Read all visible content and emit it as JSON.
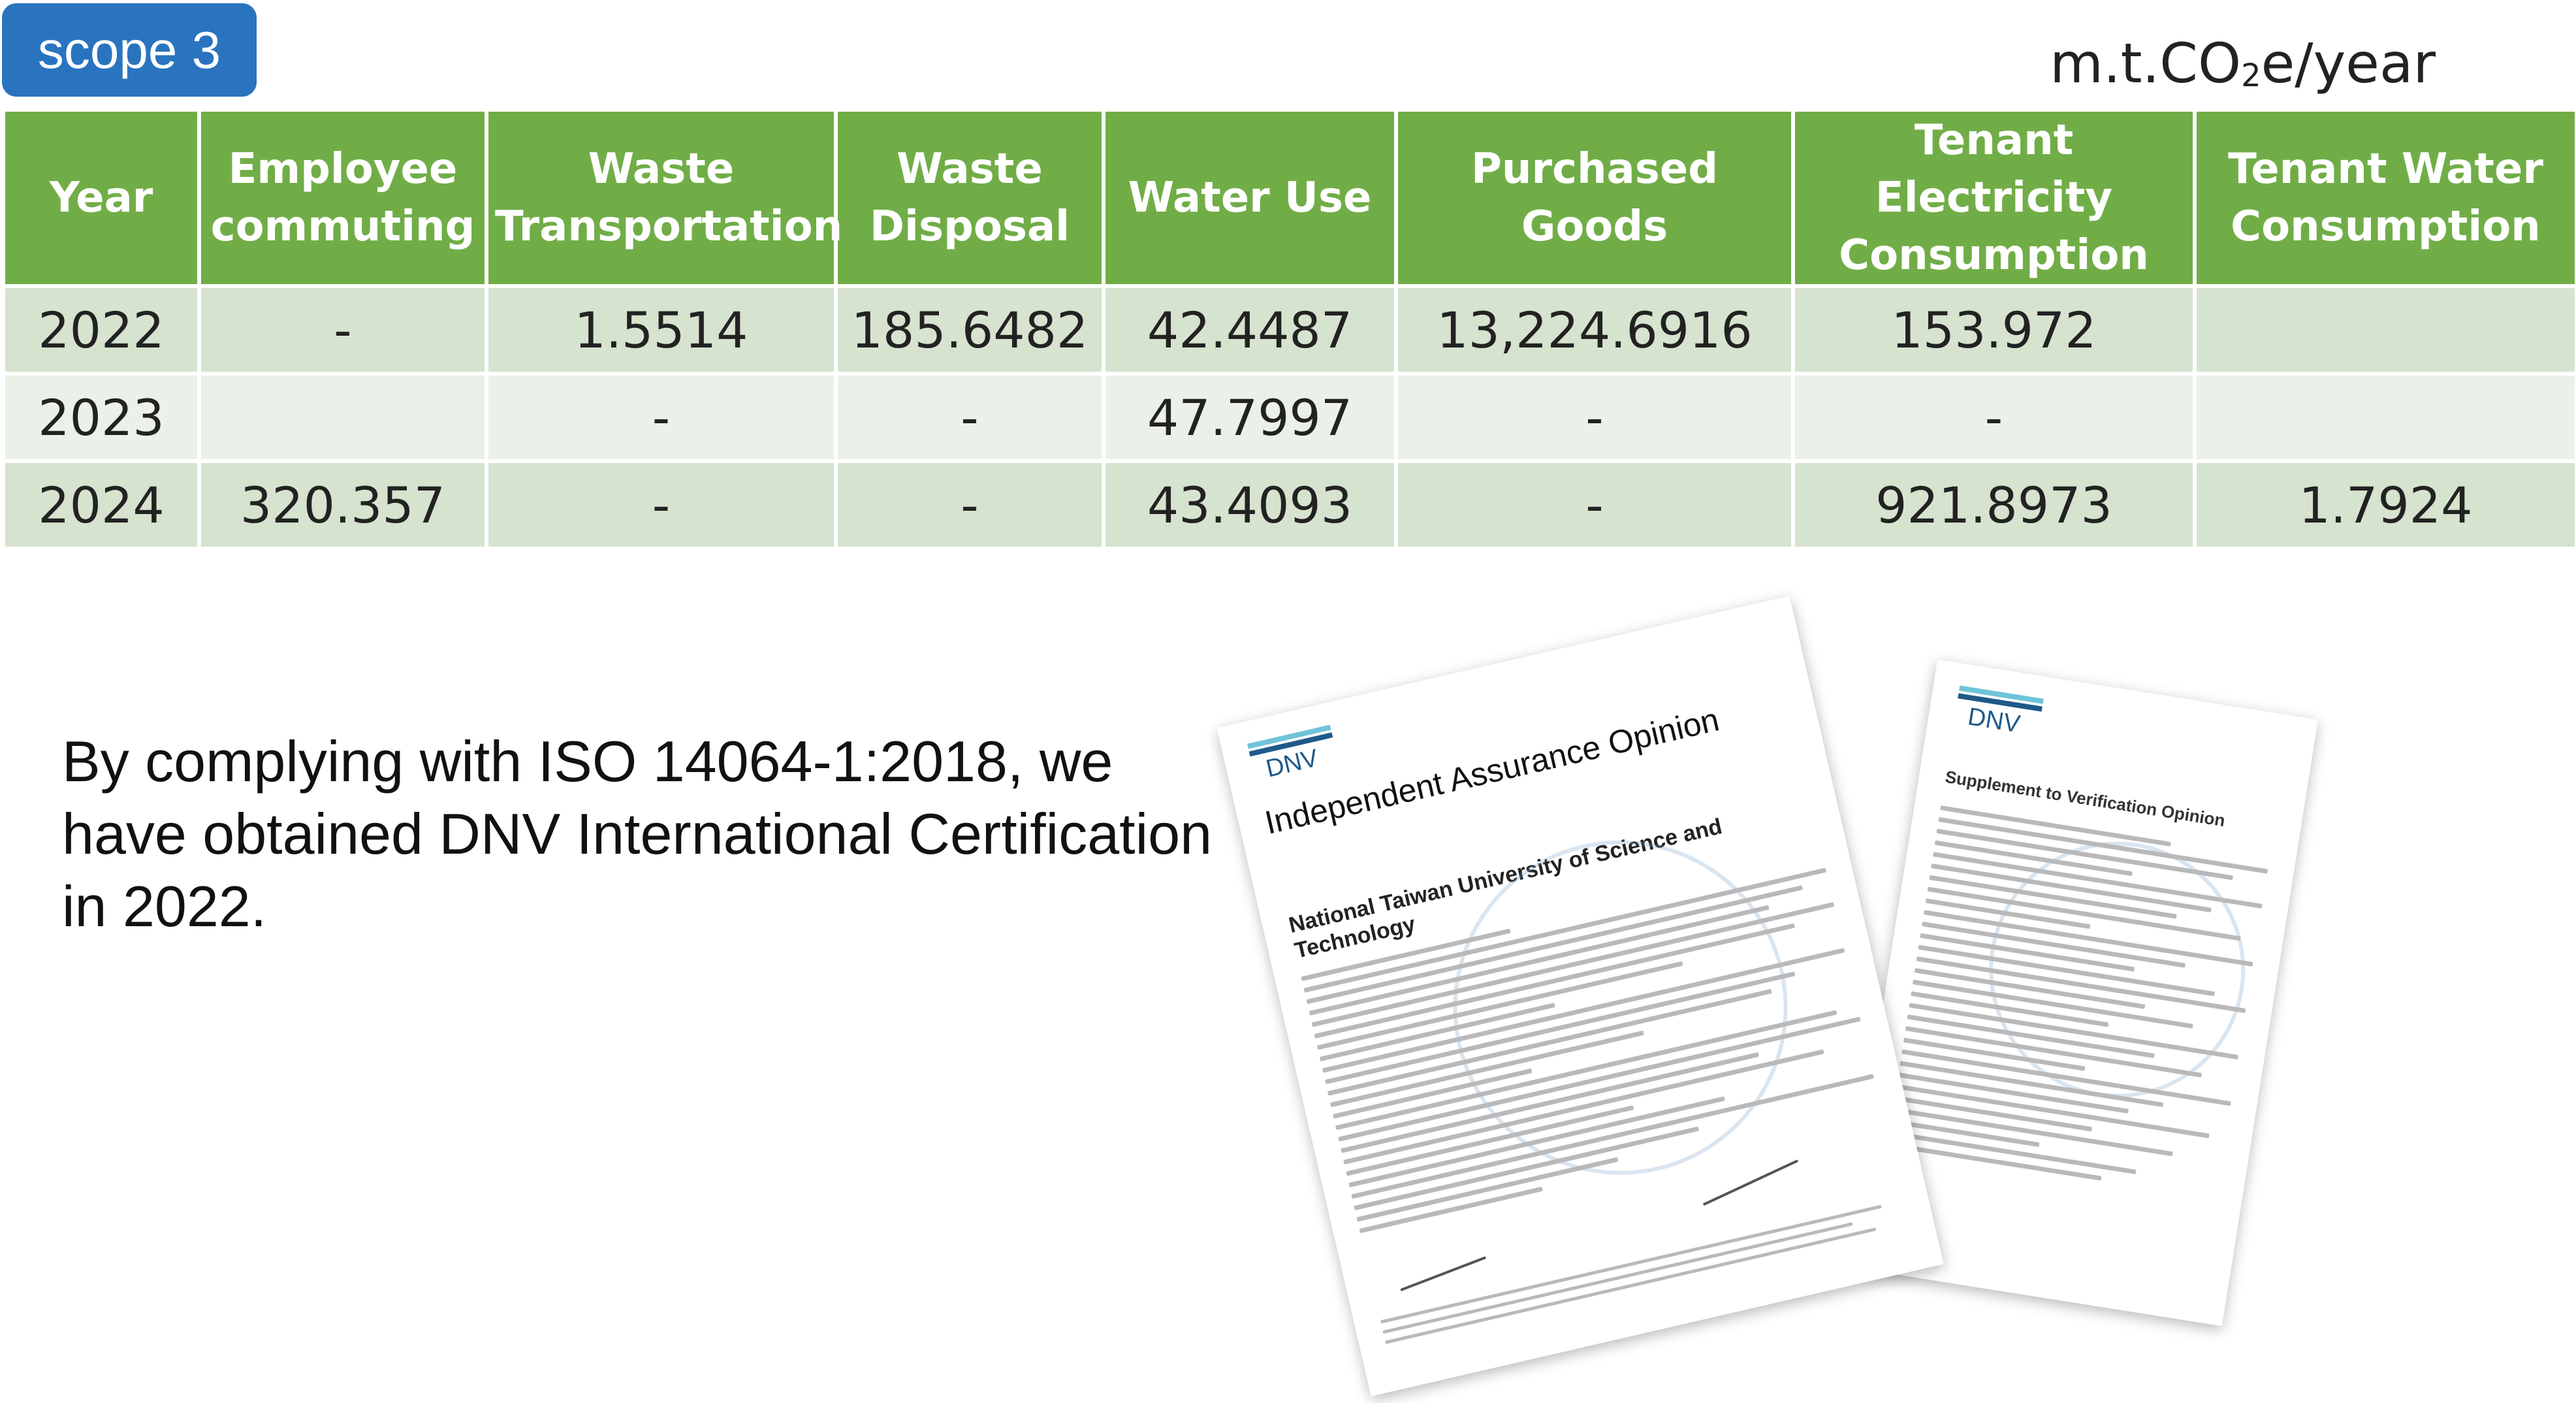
{
  "badge": {
    "label": "scope 3",
    "color": "#2a74bf"
  },
  "unit": {
    "prefix": "m.t.CO",
    "subscript": "2",
    "suffix": "e/year"
  },
  "table": {
    "header_color": "#71ad47",
    "row_colors": [
      "#d6e3cf",
      "#ebf1e8"
    ],
    "columns": [
      "Year",
      "Employee commuting",
      "Waste Transportation",
      "Waste Disposal",
      "Water Use",
      "Purchased Goods",
      "Tenant Electricity Consumption",
      "Tenant Water Consumption"
    ],
    "rows": [
      [
        "2022",
        "-",
        "1.5514",
        "185.6482",
        "42.4487",
        "13,224.6916",
        "153.972",
        ""
      ],
      [
        "2023",
        "",
        "-",
        "-",
        "47.7997",
        "-",
        "-",
        ""
      ],
      [
        "2024",
        "320.357",
        "-",
        "-",
        "43.4093",
        "-",
        "921.8973",
        "1.7924"
      ]
    ]
  },
  "statement": "By complying with ISO 14064-1:2018, we have obtained DNV International Certification in 2022.",
  "certificates": {
    "main": {
      "logo": "DNV",
      "title": "Independent Assurance Opinion",
      "organization": "National Taiwan University of Science and Technology"
    },
    "supplement": {
      "logo": "DNV",
      "title": "Supplement to Verification Opinion"
    }
  }
}
